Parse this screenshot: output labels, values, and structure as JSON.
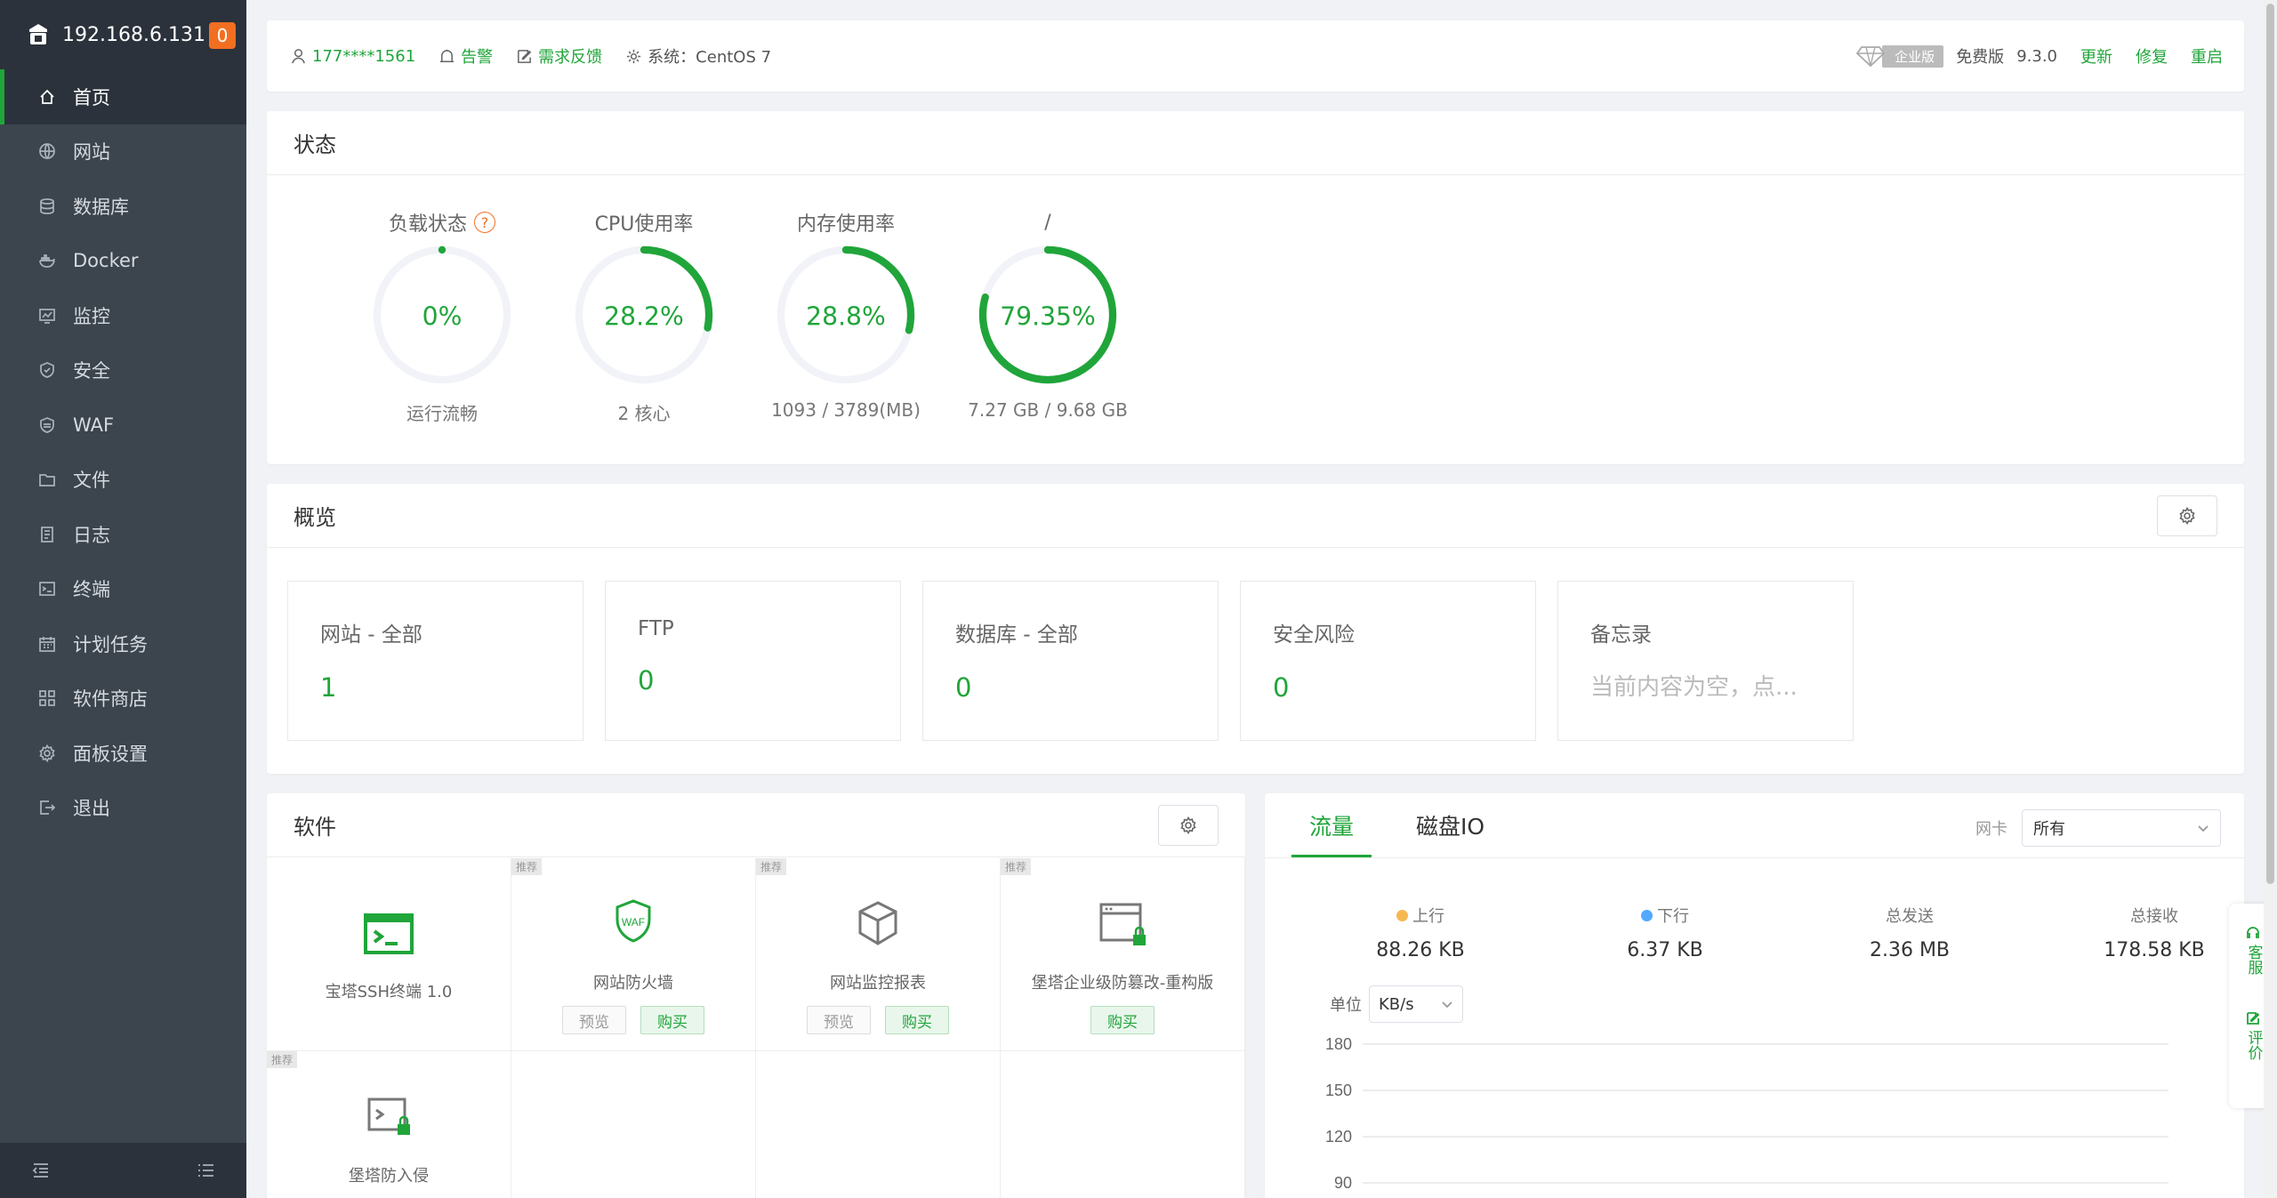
{
  "sidebar": {
    "host": "192.168.6.131",
    "badge": "0",
    "items": [
      {
        "label": "首页",
        "icon": "home-icon",
        "active": true
      },
      {
        "label": "网站",
        "icon": "globe-icon"
      },
      {
        "label": "数据库",
        "icon": "database-icon"
      },
      {
        "label": "Docker",
        "icon": "docker-icon"
      },
      {
        "label": "监控",
        "icon": "monitor-icon"
      },
      {
        "label": "安全",
        "icon": "shield-icon"
      },
      {
        "label": "WAF",
        "icon": "waf-shield-icon"
      },
      {
        "label": "文件",
        "icon": "folder-icon"
      },
      {
        "label": "日志",
        "icon": "log-icon"
      },
      {
        "label": "终端",
        "icon": "terminal-icon"
      },
      {
        "label": "计划任务",
        "icon": "calendar-icon"
      },
      {
        "label": "软件商店",
        "icon": "apps-icon"
      },
      {
        "label": "面板设置",
        "icon": "gear-icon"
      },
      {
        "label": "退出",
        "icon": "logout-icon"
      }
    ]
  },
  "topbar": {
    "user": "177****1561",
    "alert": "告警",
    "feedback": "需求反馈",
    "system": "系统：CentOS 7",
    "edition_tag": "企业版",
    "edition": "免费版",
    "version": "9.3.0",
    "update": "更新",
    "repair": "修复",
    "restart": "重启"
  },
  "status": {
    "title": "状态",
    "gauges": [
      {
        "label": "负载状态",
        "value": "0%",
        "percent": 0,
        "sub": "运行流畅",
        "has_help": true
      },
      {
        "label": "CPU使用率",
        "value": "28.2%",
        "percent": 28.2,
        "sub": "2 核心"
      },
      {
        "label": "内存使用率",
        "value": "28.8%",
        "percent": 28.8,
        "sub": "1093 / 3789(MB)"
      },
      {
        "label": "/",
        "value": "79.35%",
        "percent": 79.35,
        "sub": "7.27 GB / 9.68 GB"
      }
    ],
    "help_mark": "?"
  },
  "overview": {
    "title": "概览",
    "boxes": [
      {
        "label": "网站 - 全部",
        "value": "1"
      },
      {
        "label": "FTP",
        "value": "0"
      },
      {
        "label": "数据库 - 全部",
        "value": "0"
      },
      {
        "label": "安全风险",
        "value": "0"
      }
    ],
    "memo": {
      "label": "备忘录",
      "placeholder": "当前内容为空，点..."
    }
  },
  "software": {
    "title": "软件",
    "rec_tag": "推荐",
    "preview": "预览",
    "buy": "购买",
    "items": [
      {
        "name": "宝塔SSH终端 1.0",
        "icon": "ssh-terminal-icon",
        "rec": false,
        "preview": false,
        "buy": false
      },
      {
        "name": "网站防火墙",
        "icon": "waf-icon",
        "rec": true,
        "preview": true,
        "buy": true
      },
      {
        "name": "网站监控报表",
        "icon": "cube-icon",
        "rec": true,
        "preview": true,
        "buy": true
      },
      {
        "name": "堡塔企业级防篡改-重构版",
        "icon": "tamper-lock-icon",
        "rec": true,
        "preview": false,
        "buy": true
      },
      {
        "name": "堡塔防入侵",
        "icon": "intrusion-lock-icon",
        "rec": true,
        "preview": false,
        "buy": true
      }
    ]
  },
  "traffic": {
    "tabs": [
      "流量",
      "磁盘IO"
    ],
    "nic_label": "网卡",
    "nic_value": "所有",
    "stats": [
      {
        "label": "上行",
        "value": "88.26 KB",
        "dot": "#f7b851"
      },
      {
        "label": "下行",
        "value": "6.37 KB",
        "dot": "#52a9ff"
      },
      {
        "label": "总发送",
        "value": "2.36 MB"
      },
      {
        "label": "总接收",
        "value": "178.58 KB"
      }
    ],
    "unit_label": "单位",
    "unit_value": "KB/s"
  },
  "chart_data": {
    "type": "line",
    "title": "",
    "xlabel": "",
    "ylabel": "",
    "y_ticks": [
      180,
      150,
      120,
      90
    ],
    "ylim": [
      90,
      180
    ],
    "grid": true
  },
  "float": {
    "service": "客服",
    "rate": "评价"
  },
  "colors": {
    "accent": "#20a53a",
    "ring_bg": "#f1f3f8"
  }
}
